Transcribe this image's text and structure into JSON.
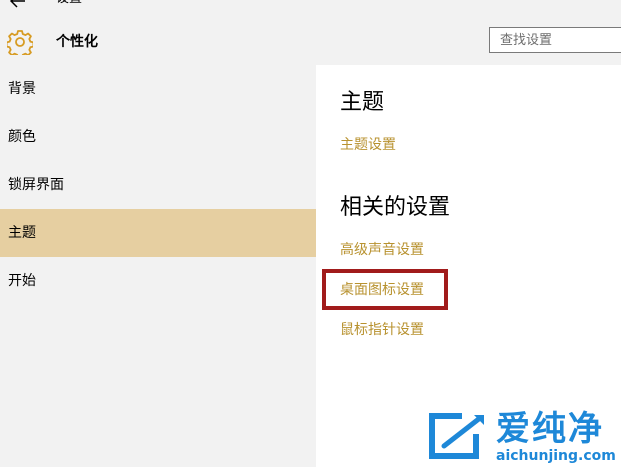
{
  "window": {
    "title": "设置"
  },
  "header": {
    "title": "个性化",
    "icon": "gear-icon",
    "search": {
      "placeholder": "查找设置",
      "value": ""
    }
  },
  "sidebar": {
    "items": [
      {
        "label": "背景",
        "selected": false
      },
      {
        "label": "颜色",
        "selected": false
      },
      {
        "label": "锁屏界面",
        "selected": false
      },
      {
        "label": "主题",
        "selected": true
      },
      {
        "label": "开始",
        "selected": false
      }
    ]
  },
  "content": {
    "theme_heading": "主题",
    "theme_settings_link": "主题设置",
    "related_heading": "相关的设置",
    "related_links": [
      "高级声音设置",
      "桌面图标设置",
      "鼠标指针设置"
    ]
  },
  "watermark": {
    "text": "爱纯净",
    "url": "aichunjing.com"
  },
  "colors": {
    "accent": "#b8922f",
    "selected_bg": "#e6cfa1",
    "highlight": "#a11b1b",
    "watermark": "#1e88d8"
  }
}
